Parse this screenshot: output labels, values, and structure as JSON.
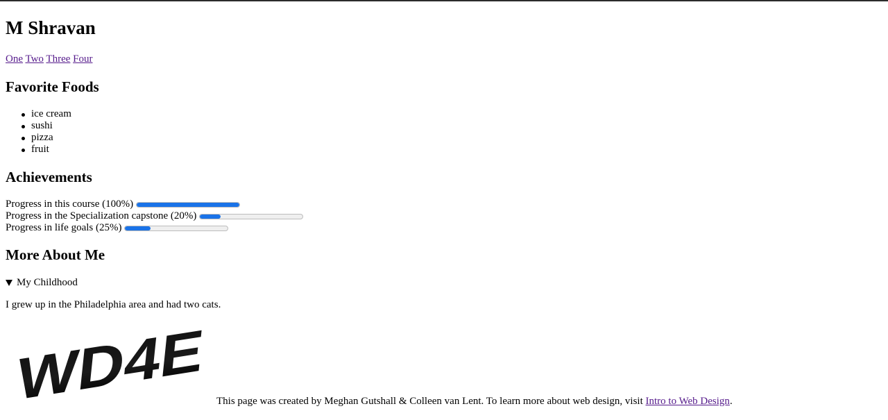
{
  "header": {
    "title": "M Shravan"
  },
  "nav": {
    "links": [
      "One",
      "Two",
      "Three",
      "Four"
    ]
  },
  "foods": {
    "heading": "Favorite Foods",
    "items": [
      "ice cream",
      "sushi",
      "pizza",
      "fruit"
    ]
  },
  "achievements": {
    "heading": "Achievements",
    "items": [
      {
        "label": "Progress in this course (100%)",
        "value": 1.0
      },
      {
        "label": "Progress in the Specialization capstone (20%)",
        "value": 0.2
      },
      {
        "label": "Progress in life goals (25%)",
        "value": 0.25
      }
    ]
  },
  "more": {
    "heading": "More About Me",
    "summary": "My Childhood",
    "body": "I grew up in the Philadelphia area and had two cats."
  },
  "logo": {
    "text": "WD4E"
  },
  "footer": {
    "text": "This page was created by Meghan Gutshall & Colleen van Lent. To learn more about web design, visit ",
    "link": "Intro to Web Design",
    "end": "."
  },
  "colors": {
    "progress_fill": "#1a73e8",
    "link": "#551a8b"
  }
}
